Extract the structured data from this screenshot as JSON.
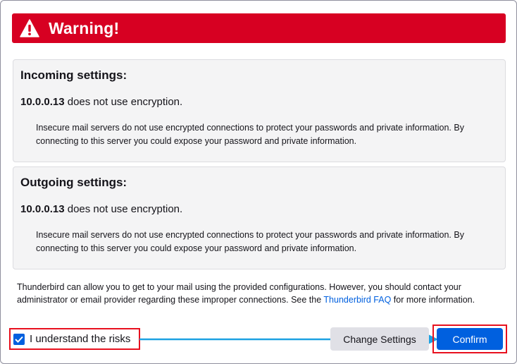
{
  "dialog": {
    "title": "Warning!",
    "accent_color": "#d70022",
    "icon": "warning-icon"
  },
  "incoming": {
    "heading": "Incoming settings:",
    "host": "10.0.0.13",
    "status": " does not use encryption.",
    "description": "Insecure mail servers do not use encrypted connections to protect your passwords and private information. By connecting to this server you could expose your password and private information."
  },
  "outgoing": {
    "heading": "Outgoing settings:",
    "host": "10.0.0.13",
    "status": " does not use encryption.",
    "description": "Insecure mail servers do not use encrypted connections to protect your passwords and private information. By connecting to this server you could expose your password and private information."
  },
  "info": {
    "text_before": "Thunderbird can allow you to get to your mail using the provided configurations. However, you should contact your administrator or email provider regarding these improper connections. See the ",
    "link": "Thunderbird FAQ",
    "text_after": " for more information."
  },
  "controls": {
    "risk_label": "I understand the risks",
    "risk_checked": true,
    "change_settings_label": "Change Settings",
    "confirm_label": "Confirm",
    "primary_color": "#0060df",
    "highlight_color": "#e8101e",
    "arrow_color": "#1da1e2"
  }
}
